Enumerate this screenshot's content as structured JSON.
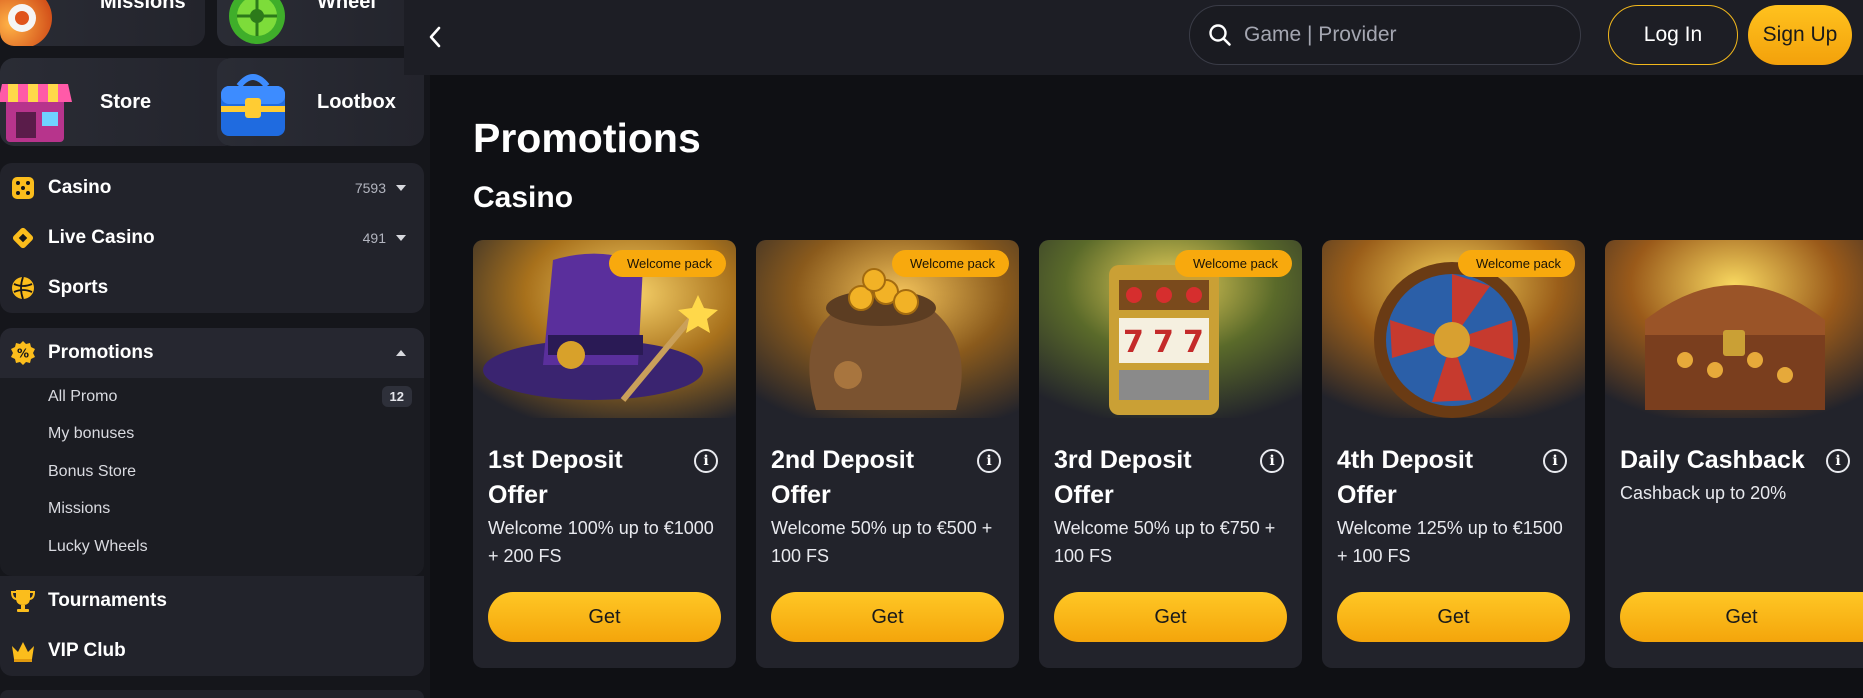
{
  "sidebar": {
    "tiles": [
      {
        "label": "Missions"
      },
      {
        "label": "Wheel"
      },
      {
        "label": "Store"
      },
      {
        "label": "Lootbox"
      }
    ],
    "nav": [
      {
        "label": "Casino",
        "count": "7593"
      },
      {
        "label": "Live Casino",
        "count": "491"
      },
      {
        "label": "Sports"
      }
    ],
    "promotions": {
      "label": "Promotions",
      "sub": [
        {
          "label": "All Promo",
          "badge": "12"
        },
        {
          "label": "My bonuses"
        },
        {
          "label": "Bonus Store"
        },
        {
          "label": "Missions"
        },
        {
          "label": "Lucky Wheels"
        }
      ]
    },
    "bottom": [
      {
        "label": "Tournaments"
      },
      {
        "label": "VIP Club"
      }
    ]
  },
  "header": {
    "search_placeholder": "Game | Provider",
    "login_label": "Log In",
    "signup_label": "Sign Up"
  },
  "main": {
    "title": "Promotions",
    "section": "Casino",
    "cards": [
      {
        "badge": "Welcome pack",
        "title": "1st Deposit Offer",
        "desc": "Welcome 100% up to €1000 + 200 FS",
        "button": "Get",
        "info": "i"
      },
      {
        "badge": "Welcome pack",
        "title": "2nd Deposit Offer",
        "desc": "Welcome 50% up to €500 + 100 FS",
        "button": "Get",
        "info": "i"
      },
      {
        "badge": "Welcome pack",
        "title": "3rd Deposit Offer",
        "desc": "Welcome 50% up to €750 + 100 FS",
        "button": "Get",
        "info": "i"
      },
      {
        "badge": "Welcome pack",
        "title": "4th Deposit Offer",
        "desc": "Welcome 125% up to €1500 + 100 FS",
        "button": "Get",
        "info": "i"
      },
      {
        "title": "Daily Cashback",
        "desc": "Cashback up to 20%",
        "button": "Get",
        "info": "i"
      }
    ]
  },
  "colors": {
    "accent": "#f8b616",
    "background": "#0f1014",
    "panel": "#22232b",
    "topbar": "#1d1e25"
  }
}
